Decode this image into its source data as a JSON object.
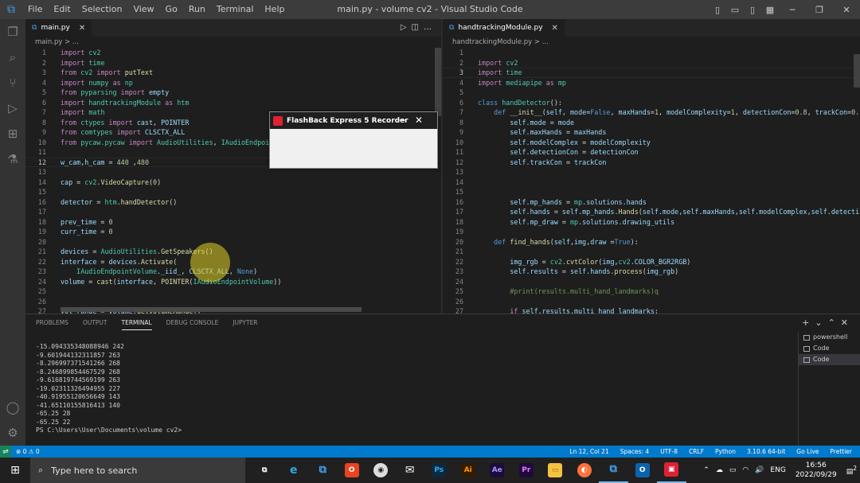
{
  "titlebar": {
    "menu": [
      "File",
      "Edit",
      "Selection",
      "View",
      "Go",
      "Run",
      "Terminal",
      "Help"
    ],
    "title": "main.py - volume cv2 - Visual Studio Code"
  },
  "editor_left": {
    "tab": "main.py",
    "breadcrumb": "main.py > ...",
    "lines": [
      {
        "n": "1",
        "h": "<span class='kw'>import</span> <span class='cl'>cv2</span>"
      },
      {
        "n": "2",
        "h": "<span class='kw'>import</span> <span class='cl'>time</span>"
      },
      {
        "n": "3",
        "h": "<span class='kw'>from</span> <span class='cl'>cv2</span> <span class='kw'>import</span> <span class='fn'>putText</span>"
      },
      {
        "n": "4",
        "h": "<span class='kw'>import</span> <span class='cl'>numpy</span> <span class='kw'>as</span> <span class='cl'>np</span>"
      },
      {
        "n": "5",
        "h": "<span class='kw'>from</span> <span class='cl'>pyparsing</span> <span class='kw'>import</span> <span class='var'>empty</span>"
      },
      {
        "n": "6",
        "h": "<span class='kw'>import</span> <span class='cl'>handtrackingModule</span> <span class='kw'>as</span> <span class='cl'>htm</span>"
      },
      {
        "n": "7",
        "h": "<span class='kw'>import</span> <span class='cl'>math</span>"
      },
      {
        "n": "8",
        "h": "<span class='kw'>from</span> <span class='cl'>ctypes</span> <span class='kw'>import</span> <span class='var'>cast</span>, <span class='var'>POINTER</span>"
      },
      {
        "n": "9",
        "h": "<span class='kw'>from</span> <span class='cl'>comtypes</span> <span class='kw'>import</span> <span class='var'>CLSCTX_ALL</span>"
      },
      {
        "n": "10",
        "h": "<span class='kw'>from</span> <span class='cl'>pycaw.pycaw</span> <span class='kw'>import</span> <span class='cl'>AudioUtilities</span>, <span class='cl'>IAudioEndpoi</span>"
      },
      {
        "n": "11",
        "h": ""
      },
      {
        "n": "12",
        "h": "<span class='var'>w_cam</span>,<span class='var'>h_cam</span> = <span class='num'>440</span> ,<span class='num'>480</span>",
        "cur": true
      },
      {
        "n": "13",
        "h": ""
      },
      {
        "n": "14",
        "h": "<span class='var'>cap</span> = <span class='cl'>cv2</span>.<span class='fn'>VideoCapture</span>(<span class='num'>0</span>)"
      },
      {
        "n": "15",
        "h": ""
      },
      {
        "n": "16",
        "h": "<span class='var'>detector</span> = <span class='cl'>htm</span>.<span class='fn'>handDetector</span>()"
      },
      {
        "n": "17",
        "h": ""
      },
      {
        "n": "18",
        "h": "<span class='var'>prev_time</span> = <span class='num'>0</span>"
      },
      {
        "n": "19",
        "h": "<span class='var'>curr_time</span> = <span class='num'>0</span>"
      },
      {
        "n": "20",
        "h": ""
      },
      {
        "n": "21",
        "h": "<span class='var'>devices</span> = <span class='cl'>AudioUtilities</span>.<span class='fn'>GetSpeakers</span>()"
      },
      {
        "n": "22",
        "h": "<span class='var'>interface</span> = <span class='var'>devices</span>.<span class='fn'>Activate</span>("
      },
      {
        "n": "23",
        "h": "    <span class='cl'>IAudioEndpointVolume</span>.<span class='var'>_iid_</span>, <span class='var'>CLSCTX_ALL</span>, <span class='bl'>None</span>)"
      },
      {
        "n": "24",
        "h": "<span class='var'>volume</span> = <span class='fn'>cast</span>(<span class='var'>interface</span>, <span class='fn'>POINTER</span>(<span class='cl'>IAudioEndpointVolume</span>))"
      },
      {
        "n": "25",
        "h": ""
      },
      {
        "n": "26",
        "h": ""
      },
      {
        "n": "27",
        "h": "<span class='var'>vol_range</span> = <span class='var'>volume</span>.<span class='fn'>GetVolumeRange</span>()"
      }
    ]
  },
  "editor_right": {
    "tab": "handtrackingModule.py",
    "breadcrumb": "handtrackingModule.py > ...",
    "lines": [
      {
        "n": "1",
        "h": ""
      },
      {
        "n": "2",
        "h": "<span class='kw'>import</span> <span class='cl'>cv2</span>"
      },
      {
        "n": "3",
        "h": "<span class='kw'>import</span> <span class='cl'>time</span>",
        "cur": true
      },
      {
        "n": "4",
        "h": "<span class='kw'>import</span> <span class='cl'>mediapipe</span> <span class='kw'>as</span> <span class='cl'>mp</span>"
      },
      {
        "n": "5",
        "h": ""
      },
      {
        "n": "6",
        "h": "<span class='bl'>class</span> <span class='cl'>handDetector</span>():"
      },
      {
        "n": "7",
        "h": "    <span class='bl'>def</span> <span class='fn'>__init__</span>(<span class='var'>self</span>, <span class='var'>mode</span>=<span class='bl'>False</span>, <span class='var'>maxHands</span>=<span class='num'>1</span>, <span class='var'>modelComplexity</span>=<span class='num'>1</span>, <span class='var'>detectionCon</span>=<span class='num'>0.8</span>, <span class='var'>trackCon</span>=<span class='num'>0.</span>"
      },
      {
        "n": "8",
        "h": "        <span class='var'>self</span>.<span class='var'>mode</span> = <span class='var'>mode</span>"
      },
      {
        "n": "9",
        "h": "        <span class='var'>self</span>.<span class='var'>maxHands</span> = <span class='var'>maxHands</span>"
      },
      {
        "n": "10",
        "h": "        <span class='var'>self</span>.<span class='var'>modelComplex</span> = <span class='var'>modelComplexity</span>"
      },
      {
        "n": "11",
        "h": "        <span class='var'>self</span>.<span class='var'>detectionCon</span> = <span class='var'>detectionCon</span>"
      },
      {
        "n": "12",
        "h": "        <span class='var'>self</span>.<span class='var'>trackCon</span> = <span class='var'>trackCon</span>"
      },
      {
        "n": "13",
        "h": ""
      },
      {
        "n": "14",
        "h": ""
      },
      {
        "n": "15",
        "h": ""
      },
      {
        "n": "16",
        "h": "        <span class='var'>self</span>.<span class='var'>mp_hands</span> = <span class='cl'>mp</span>.<span class='var'>solutions</span>.<span class='var'>hands</span>"
      },
      {
        "n": "17",
        "h": "        <span class='var'>self</span>.<span class='var'>hands</span> = <span class='var'>self</span>.<span class='var'>mp_hands</span>.<span class='fn'>Hands</span>(<span class='var'>self</span>.<span class='var'>mode</span>,<span class='var'>self</span>.<span class='var'>maxHands</span>,<span class='var'>self</span>.<span class='var'>modelComplex</span>,<span class='var'>self</span>.<span class='var'>detecti</span>"
      },
      {
        "n": "18",
        "h": "        <span class='var'>self</span>.<span class='var'>mp_draw</span> = <span class='cl'>mp</span>.<span class='var'>solutions</span>.<span class='var'>drawing_utils</span>"
      },
      {
        "n": "19",
        "h": ""
      },
      {
        "n": "20",
        "h": "    <span class='bl'>def</span> <span class='fn'>find_hands</span>(<span class='var'>self</span>,<span class='var'>img</span>,<span class='var'>draw</span> =<span class='bl'>True</span>):"
      },
      {
        "n": "21",
        "h": ""
      },
      {
        "n": "22",
        "h": "        <span class='var'>img_rgb</span> = <span class='cl'>cv2</span>.<span class='fn'>cvtColor</span>(<span class='var'>img</span>,<span class='cl'>cv2</span>.<span class='var'>COLOR_BGR2RGB</span>)"
      },
      {
        "n": "23",
        "h": "        <span class='var'>self</span>.<span class='var'>results</span> = <span class='var'>self</span>.<span class='var'>hands</span>.<span class='fn'>process</span>(<span class='var'>img_rgb</span>)"
      },
      {
        "n": "24",
        "h": ""
      },
      {
        "n": "25",
        "h": "        <span class='cm'>#print(results.multi_hand_landmarks)q</span>"
      },
      {
        "n": "26",
        "h": ""
      },
      {
        "n": "27",
        "h": "        <span class='kw'>if</span> <span class='var'>self</span>.<span class='var'>results</span>.<span class='var'>multi_hand_landmarks</span>:"
      }
    ]
  },
  "panel": {
    "tabs": [
      "PROBLEMS",
      "OUTPUT",
      "TERMINAL",
      "DEBUG CONSOLE",
      "JUPYTER"
    ],
    "active_tab": "TERMINAL",
    "terminal_lines": [
      "-15.094335348088946 242",
      "-9.601944132311857 263",
      "-8.296997371541266 268",
      "-8.246899854467529 268",
      "-9.616819744569199 263",
      "-19.02311326494955 227",
      "-40.91955120656649 143",
      "-41.65110155816413 140",
      "-65.25 28",
      "-65.25 22",
      "PS C:\\Users\\User\\Documents\\volume cv2>"
    ],
    "terminals": [
      "powershell",
      "Code",
      "Code"
    ]
  },
  "statusbar": {
    "errors": "⊗ 0 ⚠ 0",
    "right": [
      "Ln 12, Col 21",
      "Spaces: 4",
      "UTF-8",
      "CRLF",
      "Python",
      "3.10.6 64-bit",
      "Go Live",
      "Prettier"
    ]
  },
  "flashback": {
    "title": "FlashBack Express 5 Recorder"
  },
  "taskbar": {
    "search_placeholder": "Type here to search",
    "lang": "ENG",
    "time": "16:56",
    "date": "2022/09/29",
    "notif_count": "2"
  }
}
